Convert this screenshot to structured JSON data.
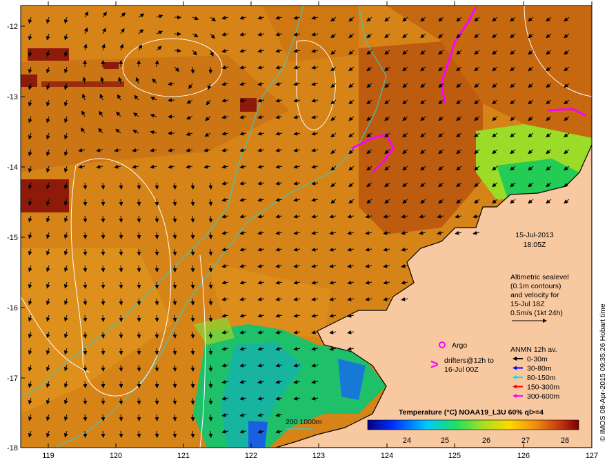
{
  "map": {
    "date": "15-Jul-2013",
    "time": "18:05Z",
    "altimetry_lines": [
      "Altimetric sealevel",
      "(0.1m contours)",
      "and velocity for",
      "15-Jul 18Z",
      "0.5m/s (1kt 24h)"
    ],
    "argo_label": "Argo",
    "drifters_lines": [
      "drifters@12h to",
      "16-Jul 00Z"
    ],
    "anmn_title": "ANMN 12h av.",
    "anmn_items": [
      {
        "label": "0-30m",
        "color": "#000000"
      },
      {
        "label": "30-80m",
        "color": "#0000ff"
      },
      {
        "label": "80-150m",
        "color": "#00e5e5"
      },
      {
        "label": "150-300m",
        "color": "#ff0000"
      },
      {
        "label": "300-600m",
        "color": "#ff00ff"
      }
    ],
    "colorbar_title": "Temperature (°C) NOAA19_L3U 60% ql>=4",
    "colorbar_ticks": [
      "24",
      "25",
      "26",
      "27",
      "28"
    ],
    "isobath_label": "200  1000m",
    "credit": "© IMOS 08-Apr-2015 09:35:26 Hobart time",
    "y_ticks": [
      "-12",
      "-13",
      "-14",
      "-15",
      "-16",
      "-17",
      "-18"
    ],
    "x_ticks": [
      "119",
      "120",
      "121",
      "122",
      "123",
      "124",
      "125",
      "126",
      "127"
    ],
    "colors": {
      "sea_warm": "#d9861a",
      "sea_hot": "#b44d0a",
      "land": "#f8c8a0",
      "cool_water": "#19c26a",
      "isobath": "#3cc8c0",
      "argo": "#ff00ff"
    }
  }
}
